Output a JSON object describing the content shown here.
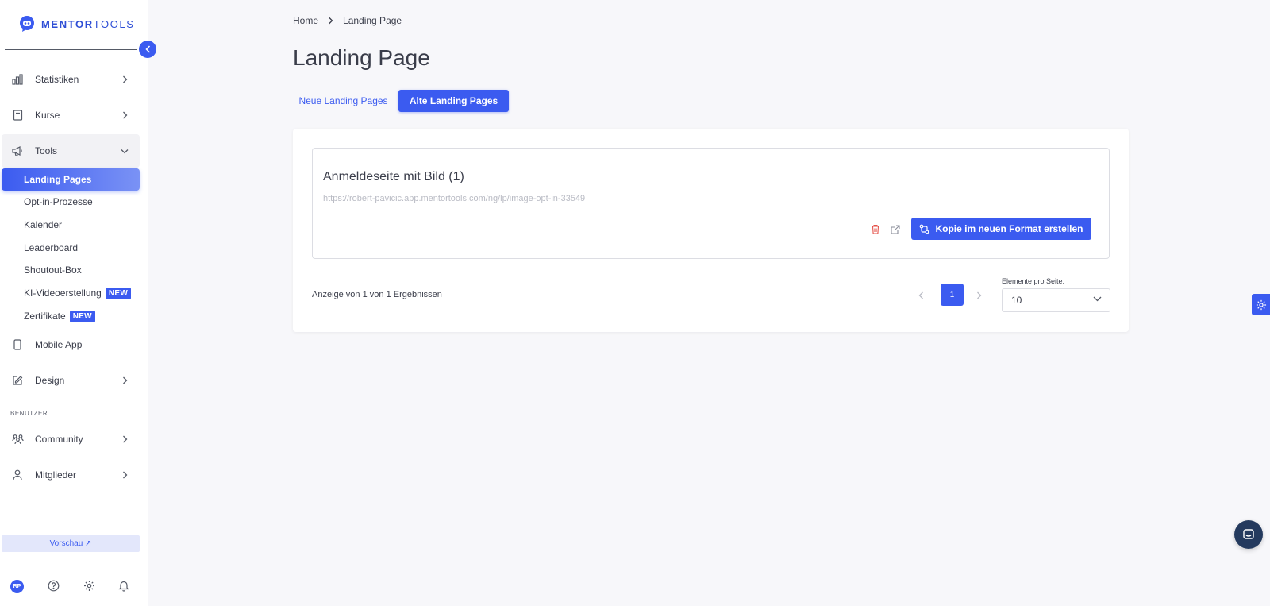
{
  "brand": {
    "name_bold": "MENTOR",
    "name_light": "TOOLS",
    "accent": "#3b5bf0"
  },
  "sidebar": {
    "nav": [
      {
        "label": "Statistiken",
        "icon": "bar-chart-icon"
      },
      {
        "label": "Kurse",
        "icon": "book-icon"
      },
      {
        "label": "Tools",
        "icon": "megaphone-icon"
      }
    ],
    "tools_sub": [
      {
        "label": "Landing Pages",
        "active": true
      },
      {
        "label": "Opt-in-Prozesse"
      },
      {
        "label": "Kalender"
      },
      {
        "label": "Leaderboard"
      },
      {
        "label": "Shoutout-Box"
      },
      {
        "label": "KI-Videoerstellung",
        "badge": "NEW"
      },
      {
        "label": "Zertifikate",
        "badge": "NEW"
      }
    ],
    "nav_more": [
      {
        "label": "Mobile App",
        "icon": "smartphone-icon"
      },
      {
        "label": "Design",
        "icon": "edit-icon"
      }
    ],
    "section_users": "BENUTZER",
    "nav_users": [
      {
        "label": "Community",
        "icon": "users-icon"
      },
      {
        "label": "Mitglieder",
        "icon": "user-icon"
      }
    ],
    "preview_label": "Vorschau ↗",
    "avatar_initials": "RP"
  },
  "breadcrumb": {
    "home": "Home",
    "current": "Landing Page"
  },
  "page_title": "Landing Page",
  "tabs": {
    "new": "Neue Landing Pages",
    "old": "Alte Landing Pages"
  },
  "landing_page": {
    "title": "Anmeldeseite mit Bild (1)",
    "url": "https://robert-pavicic.app.mentortools.com/ng/lp/image-opt-in-33549",
    "copy_button": "Kopie im neuen Format erstellen"
  },
  "pagination": {
    "results_text": "Anzeige von 1 von 1 Ergebnissen",
    "current_page": "1",
    "per_page_label": "Elemente pro Seite:",
    "per_page_value": "10"
  }
}
